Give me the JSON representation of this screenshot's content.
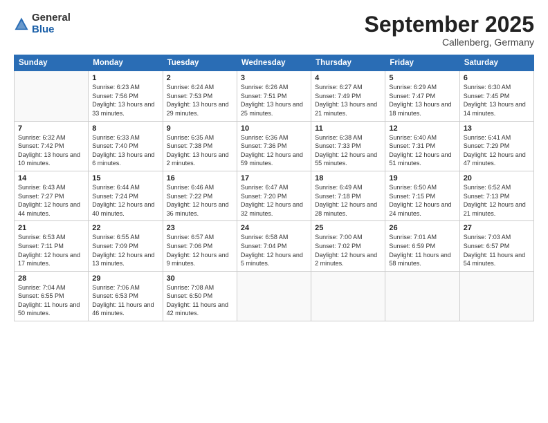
{
  "header": {
    "logo_general": "General",
    "logo_blue": "Blue",
    "month_title": "September 2025",
    "location": "Callenberg, Germany"
  },
  "days_of_week": [
    "Sunday",
    "Monday",
    "Tuesday",
    "Wednesday",
    "Thursday",
    "Friday",
    "Saturday"
  ],
  "weeks": [
    [
      {
        "day": "",
        "sunrise": "",
        "sunset": "",
        "daylight": ""
      },
      {
        "day": "1",
        "sunrise": "Sunrise: 6:23 AM",
        "sunset": "Sunset: 7:56 PM",
        "daylight": "Daylight: 13 hours and 33 minutes."
      },
      {
        "day": "2",
        "sunrise": "Sunrise: 6:24 AM",
        "sunset": "Sunset: 7:53 PM",
        "daylight": "Daylight: 13 hours and 29 minutes."
      },
      {
        "day": "3",
        "sunrise": "Sunrise: 6:26 AM",
        "sunset": "Sunset: 7:51 PM",
        "daylight": "Daylight: 13 hours and 25 minutes."
      },
      {
        "day": "4",
        "sunrise": "Sunrise: 6:27 AM",
        "sunset": "Sunset: 7:49 PM",
        "daylight": "Daylight: 13 hours and 21 minutes."
      },
      {
        "day": "5",
        "sunrise": "Sunrise: 6:29 AM",
        "sunset": "Sunset: 7:47 PM",
        "daylight": "Daylight: 13 hours and 18 minutes."
      },
      {
        "day": "6",
        "sunrise": "Sunrise: 6:30 AM",
        "sunset": "Sunset: 7:45 PM",
        "daylight": "Daylight: 13 hours and 14 minutes."
      }
    ],
    [
      {
        "day": "7",
        "sunrise": "Sunrise: 6:32 AM",
        "sunset": "Sunset: 7:42 PM",
        "daylight": "Daylight: 13 hours and 10 minutes."
      },
      {
        "day": "8",
        "sunrise": "Sunrise: 6:33 AM",
        "sunset": "Sunset: 7:40 PM",
        "daylight": "Daylight: 13 hours and 6 minutes."
      },
      {
        "day": "9",
        "sunrise": "Sunrise: 6:35 AM",
        "sunset": "Sunset: 7:38 PM",
        "daylight": "Daylight: 13 hours and 2 minutes."
      },
      {
        "day": "10",
        "sunrise": "Sunrise: 6:36 AM",
        "sunset": "Sunset: 7:36 PM",
        "daylight": "Daylight: 12 hours and 59 minutes."
      },
      {
        "day": "11",
        "sunrise": "Sunrise: 6:38 AM",
        "sunset": "Sunset: 7:33 PM",
        "daylight": "Daylight: 12 hours and 55 minutes."
      },
      {
        "day": "12",
        "sunrise": "Sunrise: 6:40 AM",
        "sunset": "Sunset: 7:31 PM",
        "daylight": "Daylight: 12 hours and 51 minutes."
      },
      {
        "day": "13",
        "sunrise": "Sunrise: 6:41 AM",
        "sunset": "Sunset: 7:29 PM",
        "daylight": "Daylight: 12 hours and 47 minutes."
      }
    ],
    [
      {
        "day": "14",
        "sunrise": "Sunrise: 6:43 AM",
        "sunset": "Sunset: 7:27 PM",
        "daylight": "Daylight: 12 hours and 44 minutes."
      },
      {
        "day": "15",
        "sunrise": "Sunrise: 6:44 AM",
        "sunset": "Sunset: 7:24 PM",
        "daylight": "Daylight: 12 hours and 40 minutes."
      },
      {
        "day": "16",
        "sunrise": "Sunrise: 6:46 AM",
        "sunset": "Sunset: 7:22 PM",
        "daylight": "Daylight: 12 hours and 36 minutes."
      },
      {
        "day": "17",
        "sunrise": "Sunrise: 6:47 AM",
        "sunset": "Sunset: 7:20 PM",
        "daylight": "Daylight: 12 hours and 32 minutes."
      },
      {
        "day": "18",
        "sunrise": "Sunrise: 6:49 AM",
        "sunset": "Sunset: 7:18 PM",
        "daylight": "Daylight: 12 hours and 28 minutes."
      },
      {
        "day": "19",
        "sunrise": "Sunrise: 6:50 AM",
        "sunset": "Sunset: 7:15 PM",
        "daylight": "Daylight: 12 hours and 24 minutes."
      },
      {
        "day": "20",
        "sunrise": "Sunrise: 6:52 AM",
        "sunset": "Sunset: 7:13 PM",
        "daylight": "Daylight: 12 hours and 21 minutes."
      }
    ],
    [
      {
        "day": "21",
        "sunrise": "Sunrise: 6:53 AM",
        "sunset": "Sunset: 7:11 PM",
        "daylight": "Daylight: 12 hours and 17 minutes."
      },
      {
        "day": "22",
        "sunrise": "Sunrise: 6:55 AM",
        "sunset": "Sunset: 7:09 PM",
        "daylight": "Daylight: 12 hours and 13 minutes."
      },
      {
        "day": "23",
        "sunrise": "Sunrise: 6:57 AM",
        "sunset": "Sunset: 7:06 PM",
        "daylight": "Daylight: 12 hours and 9 minutes."
      },
      {
        "day": "24",
        "sunrise": "Sunrise: 6:58 AM",
        "sunset": "Sunset: 7:04 PM",
        "daylight": "Daylight: 12 hours and 5 minutes."
      },
      {
        "day": "25",
        "sunrise": "Sunrise: 7:00 AM",
        "sunset": "Sunset: 7:02 PM",
        "daylight": "Daylight: 12 hours and 2 minutes."
      },
      {
        "day": "26",
        "sunrise": "Sunrise: 7:01 AM",
        "sunset": "Sunset: 6:59 PM",
        "daylight": "Daylight: 11 hours and 58 minutes."
      },
      {
        "day": "27",
        "sunrise": "Sunrise: 7:03 AM",
        "sunset": "Sunset: 6:57 PM",
        "daylight": "Daylight: 11 hours and 54 minutes."
      }
    ],
    [
      {
        "day": "28",
        "sunrise": "Sunrise: 7:04 AM",
        "sunset": "Sunset: 6:55 PM",
        "daylight": "Daylight: 11 hours and 50 minutes."
      },
      {
        "day": "29",
        "sunrise": "Sunrise: 7:06 AM",
        "sunset": "Sunset: 6:53 PM",
        "daylight": "Daylight: 11 hours and 46 minutes."
      },
      {
        "day": "30",
        "sunrise": "Sunrise: 7:08 AM",
        "sunset": "Sunset: 6:50 PM",
        "daylight": "Daylight: 11 hours and 42 minutes."
      },
      {
        "day": "",
        "sunrise": "",
        "sunset": "",
        "daylight": ""
      },
      {
        "day": "",
        "sunrise": "",
        "sunset": "",
        "daylight": ""
      },
      {
        "day": "",
        "sunrise": "",
        "sunset": "",
        "daylight": ""
      },
      {
        "day": "",
        "sunrise": "",
        "sunset": "",
        "daylight": ""
      }
    ]
  ]
}
